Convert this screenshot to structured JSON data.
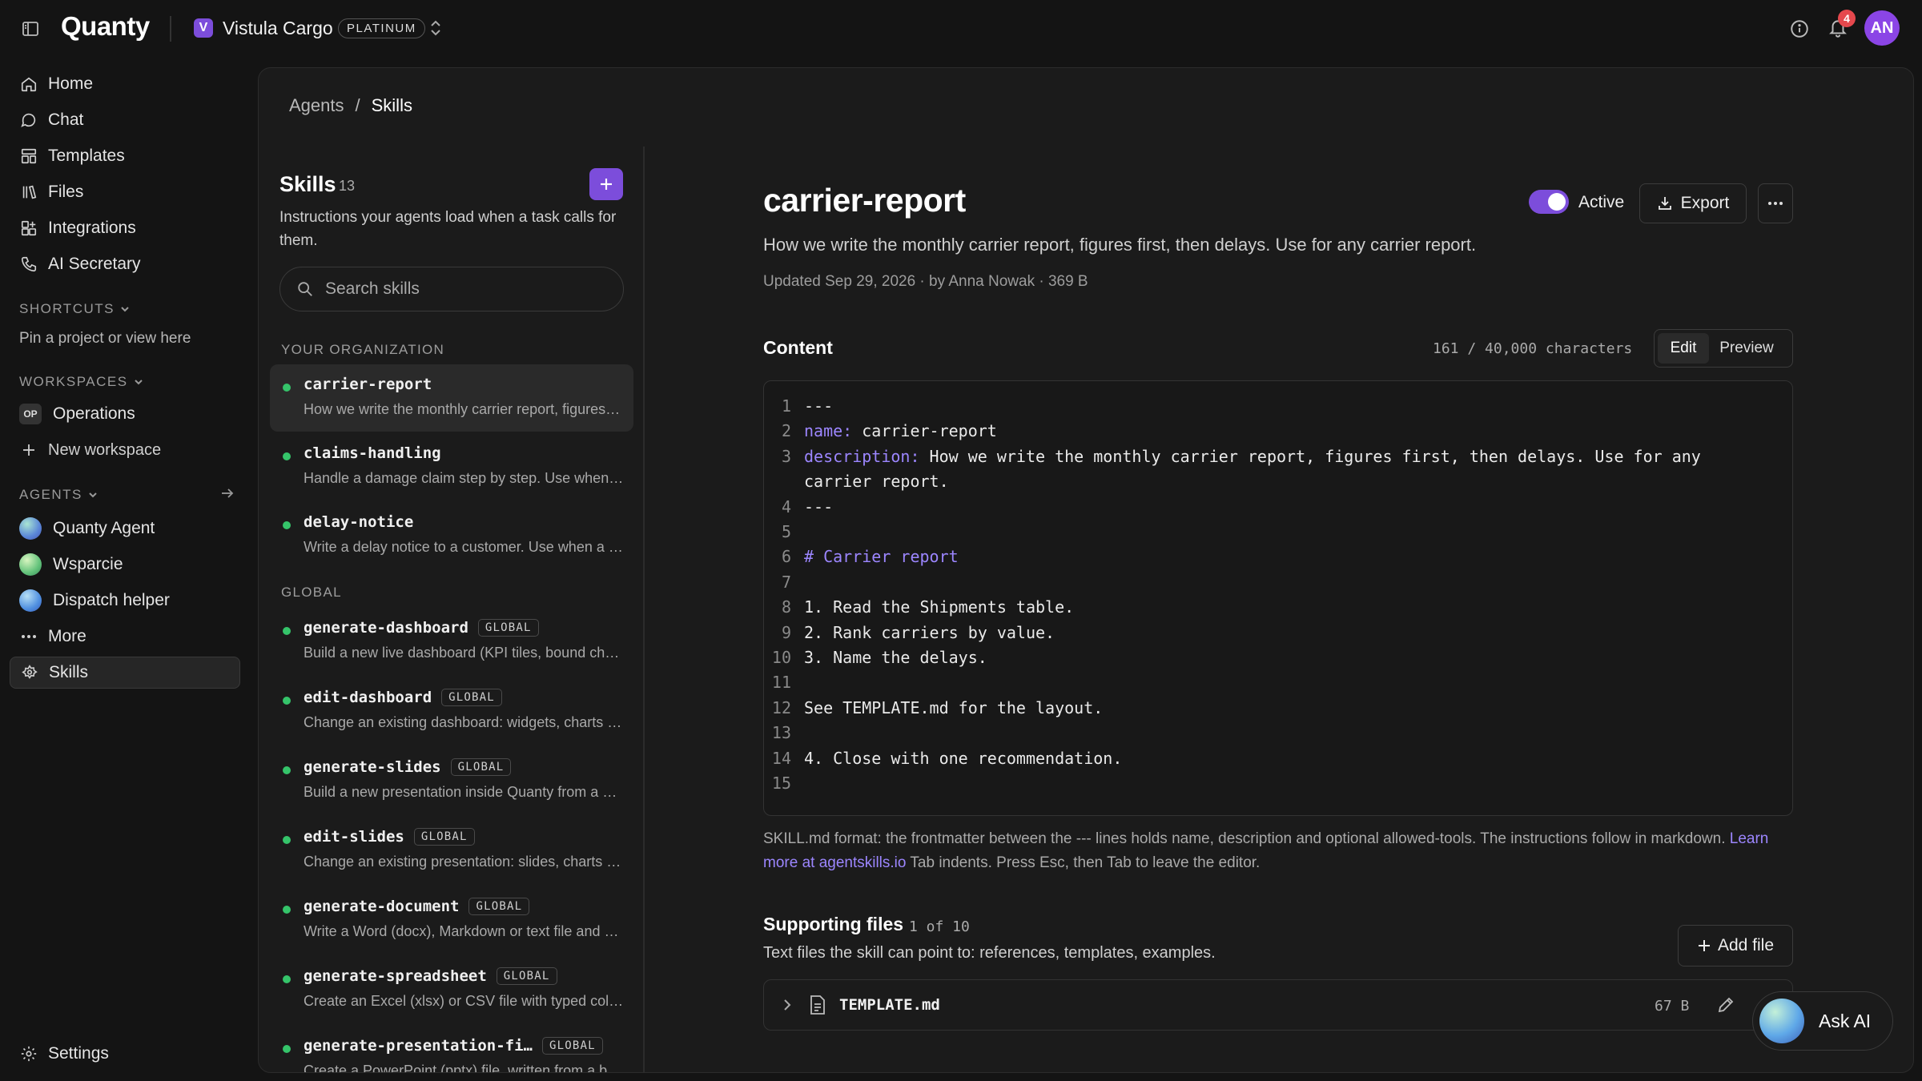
{
  "topbar": {
    "brand": "Quanty",
    "org_initial": "V",
    "org_name": "Vistula Cargo",
    "plan": "PLATINUM",
    "notifications": "4",
    "avatar": "AN"
  },
  "nav": {
    "items": [
      {
        "label": "Home",
        "icon": "home-icon"
      },
      {
        "label": "Chat",
        "icon": "chat-icon"
      },
      {
        "label": "Templates",
        "icon": "templates-icon"
      },
      {
        "label": "Files",
        "icon": "files-icon"
      },
      {
        "label": "Integrations",
        "icon": "integrations-icon"
      },
      {
        "label": "AI Secretary",
        "icon": "phone-icon"
      }
    ],
    "shortcuts_label": "SHORTCUTS",
    "shortcuts_hint": "Pin a project or view here",
    "workspaces_label": "WORKSPACES",
    "workspace_badge": "OP",
    "workspace_name": "Operations",
    "new_workspace": "New workspace",
    "agents_label": "AGENTS",
    "agents": [
      "Quanty Agent",
      "Wsparcie",
      "Dispatch helper"
    ],
    "more": "More",
    "skills": "Skills",
    "settings": "Settings"
  },
  "breadcrumb": {
    "parent": "Agents",
    "sep": "/",
    "current": "Skills"
  },
  "skills_panel": {
    "title": "Skills",
    "count": "13",
    "description": "Instructions your agents load when a task calls for them.",
    "search_placeholder": "Search skills",
    "group_org": "YOUR ORGANIZATION",
    "group_global": "GLOBAL",
    "org_skills": [
      {
        "name": "carrier-report",
        "desc": "How we write the monthly carrier report, figures first, then delays. Use for any carrier report."
      },
      {
        "name": "claims-handling",
        "desc": "Handle a damage claim step by step. Use when a customer reports damaged goods."
      },
      {
        "name": "delay-notice",
        "desc": "Write a delay notice to a customer. Use when a shipment is late."
      }
    ],
    "global_badge": "GLOBAL",
    "global_skills": [
      {
        "name": "generate-dashboard",
        "desc": "Build a new live dashboard (KPI tiles, bound charts and tables)."
      },
      {
        "name": "edit-dashboard",
        "desc": "Change an existing dashboard: widgets, charts and layout."
      },
      {
        "name": "generate-slides",
        "desc": "Build a new presentation inside Quanty from a brief."
      },
      {
        "name": "edit-slides",
        "desc": "Change an existing presentation: slides, charts and text."
      },
      {
        "name": "generate-document",
        "desc": "Write a Word (docx), Markdown or text file and save it."
      },
      {
        "name": "generate-spreadsheet",
        "desc": "Create an Excel (xlsx) or CSV file with typed columns."
      },
      {
        "name": "generate-presentation-fi…",
        "desc": "Create a PowerPoint (pptx) file, written from a brief."
      }
    ]
  },
  "detail": {
    "title": "carrier-report",
    "active_label": "Active",
    "export_label": "Export",
    "description": "How we write the monthly carrier report, figures first, then delays. Use for any carrier report.",
    "meta": "Updated Sep 29, 2026 · by Anna Nowak · 369 B",
    "content_label": "Content",
    "char_count": "161 / 40,000 characters",
    "tab_edit": "Edit",
    "tab_preview": "Preview",
    "code_lines": [
      {
        "n": "1",
        "key": "",
        "text": "---"
      },
      {
        "n": "2",
        "key": "name:",
        "text": " carrier-report"
      },
      {
        "n": "3",
        "key": "description:",
        "text": " How we write the monthly carrier report, figures first, then delays. Use for any carrier report."
      },
      {
        "n": "4",
        "key": "",
        "text": "---"
      },
      {
        "n": "5",
        "key": "",
        "text": ""
      },
      {
        "n": "6",
        "key": "# Carrier report",
        "text": ""
      },
      {
        "n": "7",
        "key": "",
        "text": ""
      },
      {
        "n": "8",
        "key": "",
        "text": "1. Read the Shipments table."
      },
      {
        "n": "9",
        "key": "",
        "text": "2. Rank carriers by value."
      },
      {
        "n": "10",
        "key": "",
        "text": "3. Name the delays."
      },
      {
        "n": "11",
        "key": "",
        "text": ""
      },
      {
        "n": "12",
        "key": "",
        "text": "See TEMPLATE.md for the layout."
      },
      {
        "n": "13",
        "key": "",
        "text": ""
      },
      {
        "n": "14",
        "key": "",
        "text": "4. Close with one recommendation."
      },
      {
        "n": "15",
        "key": "",
        "text": ""
      }
    ],
    "hint_text": "SKILL.md format: the frontmatter between the --- lines holds name, description and optional allowed-tools. The instructions follow in markdown.",
    "hint_link": "Learn more at agentskills.io",
    "hint_tail": "Tab indents. Press Esc, then Tab to leave the editor.",
    "supporting_title": "Supporting files",
    "supporting_count": "1 of 10",
    "supporting_desc": "Text files the skill can point to: references, templates, examples.",
    "add_file": "Add file",
    "file_name": "TEMPLATE.md",
    "file_size": "67 B"
  },
  "ask_ai": "Ask AI",
  "colors": {
    "accent": "#7c4ddb",
    "active_dot": "#35c46a",
    "badge_red": "#e5484d"
  }
}
